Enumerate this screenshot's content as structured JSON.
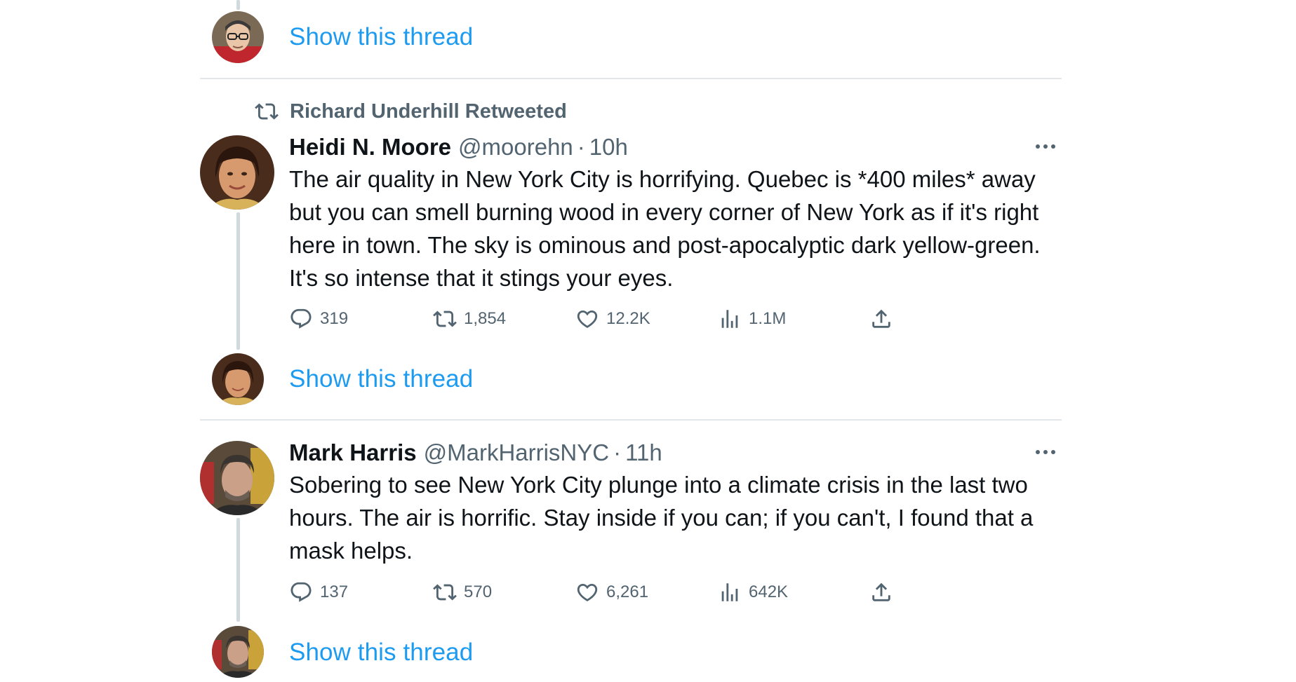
{
  "thread_link_label": "Show this thread",
  "retweet_context": {
    "text": "Richard Underhill Retweeted"
  },
  "tweets": [
    {
      "name": "Heidi N. Moore",
      "handle": "@moorehn",
      "separator": "·",
      "time": "10h",
      "text": "The air quality in New York City is horrifying. Quebec is *400 miles* away but you can smell burning wood in every corner of New York as if it's right here in town. The sky is ominous and post-apocalyptic dark yellow-green. It's so intense that it stings your eyes.",
      "replies": "319",
      "retweets": "1,854",
      "likes": "12.2K",
      "views": "1.1M"
    },
    {
      "name": "Mark Harris",
      "handle": "@MarkHarrisNYC",
      "separator": "·",
      "time": "11h",
      "text": "Sobering to see New York City plunge into a climate crisis in the last two hours. The air is horrific. Stay inside if you can; if you can't, I found that a mask helps.",
      "replies": "137",
      "retweets": "570",
      "likes": "6,261",
      "views": "642K"
    }
  ],
  "icons": {
    "reply": "reply-icon",
    "retweet": "retweet-icon",
    "like": "heart-icon",
    "views": "views-icon",
    "share": "share-icon",
    "more": "more-icon"
  },
  "colors": {
    "link": "#1d9bf0",
    "secondary_text": "#536471",
    "primary_text": "#0f1419",
    "divider": "#e4e7ea",
    "thread_line": "#cfd9de"
  }
}
